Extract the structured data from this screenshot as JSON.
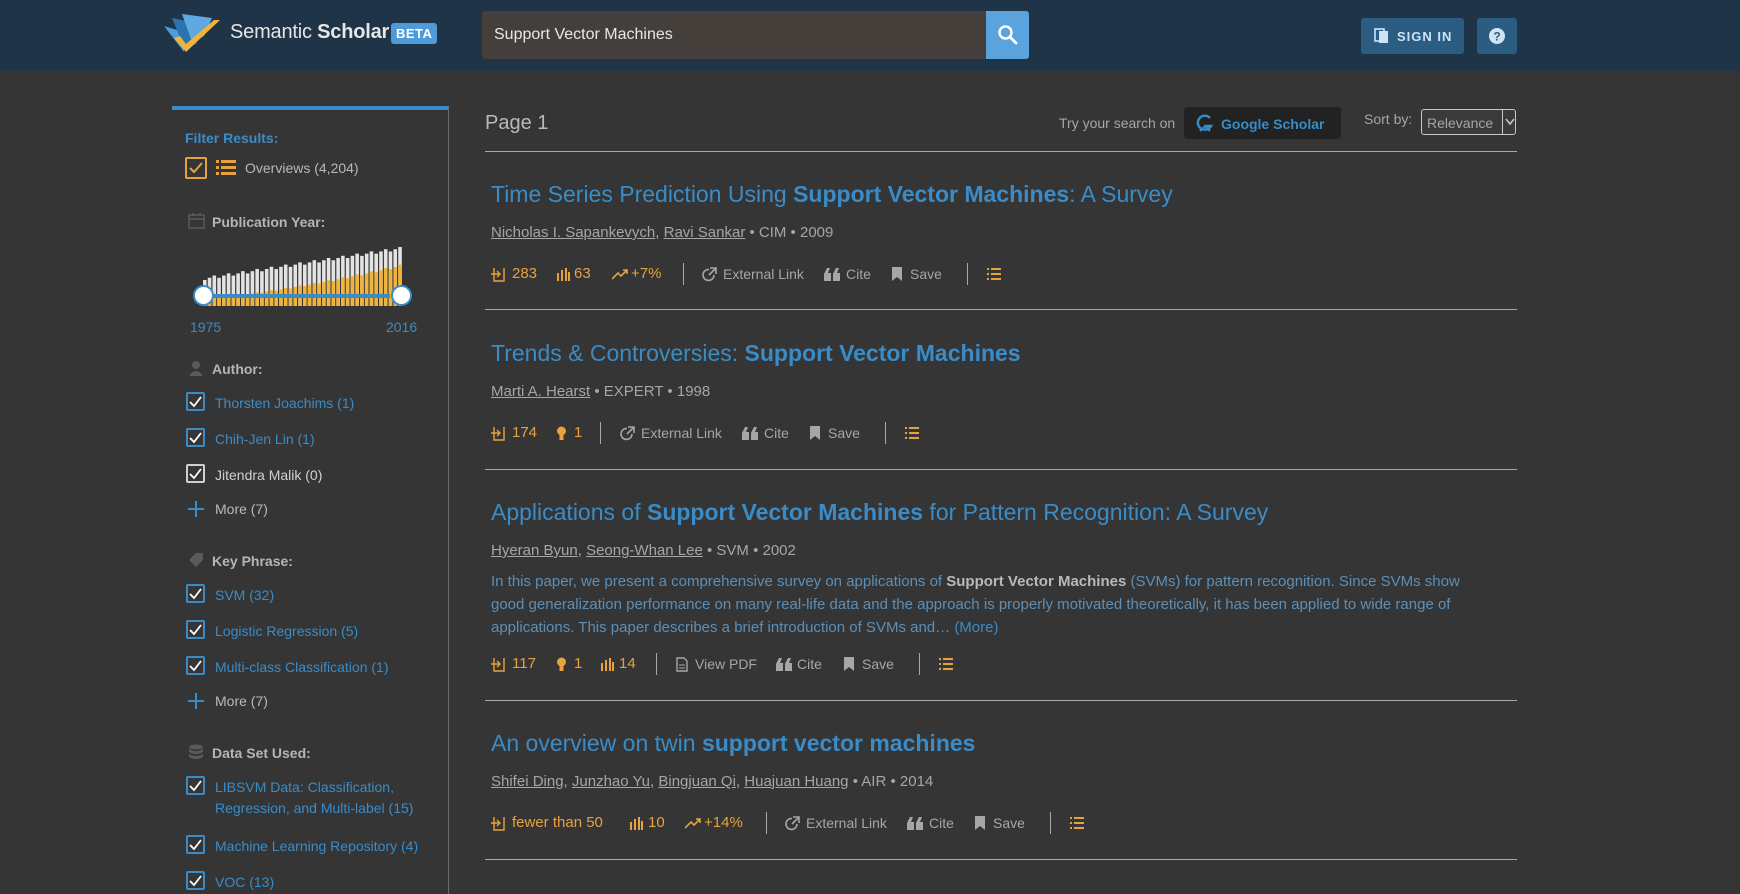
{
  "header": {
    "brand_part1": "Semantic",
    "brand_part2": "Scholar",
    "beta": "BETA",
    "search_value": "Support Vector Machines",
    "signin_label": "SIGN IN"
  },
  "sidebar": {
    "filter_heading": "Filter Results:",
    "overviews_label": "Overviews (4,204)",
    "pub_year_heading": "Publication Year:",
    "year_start": "1975",
    "year_end": "2016",
    "author_heading": "Author:",
    "authors": [
      {
        "label": "Thorsten Joachims (1)"
      },
      {
        "label": "Chih-Jen Lin (1)"
      },
      {
        "label": "Jitendra Malik (0)"
      }
    ],
    "author_more": "More (7)",
    "keyphrase_heading": "Key Phrase:",
    "keyphrases": [
      {
        "label": "SVM (32)"
      },
      {
        "label": "Logistic Regression (5)"
      },
      {
        "label": "Multi-class Classification (1)"
      }
    ],
    "keyphrase_more": "More (7)",
    "dataset_heading": "Data Set Used:",
    "datasets": [
      {
        "line1": "LIBSVM Data: Classification,",
        "line2": "Regression, and Multi-label (15)"
      },
      {
        "line1": "Machine Learning Repository (4)"
      },
      {
        "line1": "VOC (13)"
      }
    ]
  },
  "results_header": {
    "page": "Page 1",
    "try_text": "Try your search on",
    "google_scholar": "Google Scholar",
    "sort_by": "Sort by:",
    "sort_value": "Relevance"
  },
  "results": [
    {
      "title_pre": "Time Series Prediction Using ",
      "title_bold": "Support Vector Machines",
      "title_post": ": A Survey",
      "authors": [
        "Nicholas I. Sapankevych",
        "Ravi Sankar"
      ],
      "venue_year": " • CIM • 2009",
      "citations": "283",
      "influence": "63",
      "velocity": "+7%"
    },
    {
      "title_pre": "Trends & Controversies: ",
      "title_bold": "Support Vector Machines",
      "title_post": "",
      "authors": [
        "Marti A. Hearst"
      ],
      "venue_year": " • EXPERT • 1998",
      "citations": "174",
      "highly_influential": "1"
    },
    {
      "title_pre": "Applications of ",
      "title_bold": "Support Vector Machines",
      "title_post": " for Pattern Recognition: A Survey",
      "authors": [
        "Hyeran Byun",
        "Seong-Whan Lee"
      ],
      "venue_year": " • SVM • 2002",
      "abstract_pre": "In this paper, we present a comprehensive survey on applications of ",
      "abstract_bold": "Support Vector Machines",
      "abstract_post": " (SVMs) for pattern recognition. Since SVMs show good generalization performance on many real-life data and the approach is properly motivated theoretically, it has been applied to wide range of applications. This paper describes a brief introduction of SVMs and… ",
      "abstract_more": "(More)",
      "citations": "117",
      "highly_influential": "1",
      "influence": "14"
    },
    {
      "title_pre": "An overview on twin ",
      "title_bold": "support vector machines",
      "title_post": "",
      "authors": [
        "Shifei Ding",
        "Junzhao Yu",
        "Bingjuan Qi",
        "Huajuan Huang"
      ],
      "venue_year": " • AIR • 2014",
      "citations": "fewer than 50",
      "influence": "10",
      "velocity": "+14%"
    }
  ],
  "actions": {
    "external_link": "External Link",
    "view_pdf": "View PDF",
    "cite": "Cite",
    "save": "Save"
  },
  "colors": {
    "header_bg": "#1f3446",
    "page_bg": "#353535",
    "accent_blue": "#3a8cc8",
    "accent_orange": "#e8a23d"
  },
  "icons": [
    "logo-icon",
    "search-icon",
    "sign-in-icon",
    "help-icon",
    "calendar-icon",
    "author-icon",
    "tag-icon",
    "database-icon",
    "check-icon",
    "list-icon",
    "plus-icon",
    "google-scholar-icon",
    "chevron-down-icon",
    "citation-icon",
    "influence-bar-icon",
    "trend-icon",
    "lightbulb-icon",
    "external-link-icon",
    "pdf-icon",
    "quote-icon",
    "bookmark-icon"
  ]
}
